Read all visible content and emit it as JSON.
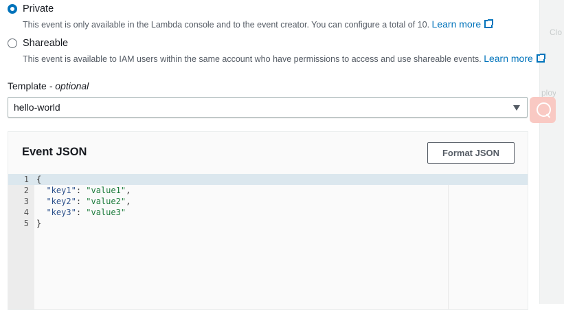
{
  "visibility": {
    "options": [
      {
        "label": "Private",
        "selected": true,
        "description": "This event is only available in the Lambda console and to the event creator. You can configure a total of 10.",
        "link": "Learn more"
      },
      {
        "label": "Shareable",
        "selected": false,
        "description": "This event is available to IAM users within the same account who have permissions to access and use shareable events.",
        "link": "Learn more"
      }
    ]
  },
  "template": {
    "label": "Template",
    "optional": "- optional",
    "value": "hello-world"
  },
  "editor": {
    "title": "Event JSON",
    "format_button": "Format JSON",
    "lines": [
      {
        "n": "1",
        "pre": "{",
        "key": "",
        "sep": "",
        "val": "",
        "post": ""
      },
      {
        "n": "2",
        "pre": "  ",
        "key": "\"key1\"",
        "sep": ": ",
        "val": "\"value1\"",
        "post": ","
      },
      {
        "n": "3",
        "pre": "  ",
        "key": "\"key2\"",
        "sep": ": ",
        "val": "\"value2\"",
        "post": ","
      },
      {
        "n": "4",
        "pre": "  ",
        "key": "\"key3\"",
        "sep": ": ",
        "val": "\"value3\"",
        "post": ""
      },
      {
        "n": "5",
        "pre": "}",
        "key": "",
        "sep": "",
        "val": "",
        "post": ""
      }
    ]
  },
  "side": {
    "text1": "Clo",
    "text2": "ploy"
  },
  "colors": {
    "accent": "#0073bb",
    "search_button": "#f9c9c3"
  }
}
